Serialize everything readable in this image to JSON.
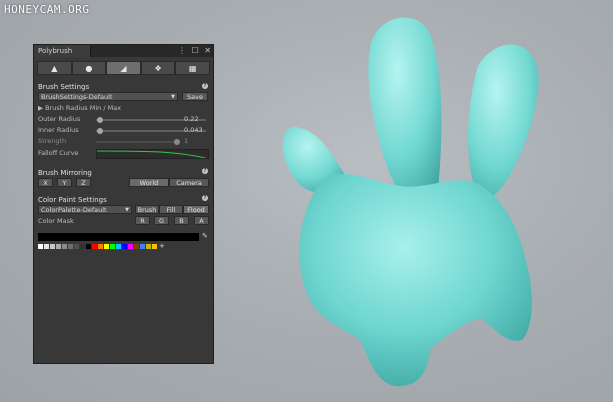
{
  "watermark": "HONEYCAM.ORG",
  "window": {
    "title": "Polybrush",
    "controls": [
      "⋮",
      "☐",
      "✕"
    ]
  },
  "toolbar": {
    "tools": [
      {
        "icon": "raise-lower-icon",
        "glyph": "▲"
      },
      {
        "icon": "smooth-icon",
        "glyph": "●"
      },
      {
        "icon": "paint-vertex-icon",
        "glyph": "◢"
      },
      {
        "icon": "scatter-prefab-icon",
        "glyph": "❖"
      },
      {
        "icon": "texture-paint-icon",
        "glyph": "▦"
      }
    ],
    "active_index": 2
  },
  "brush_settings": {
    "header": "Brush Settings",
    "preset": "BrushSettings-Default",
    "save_label": "Save",
    "radius_toggle": "Brush Radius Min / Max",
    "outer_radius_label": "Outer Radius",
    "outer_radius_value": "0.22",
    "inner_radius_label": "Inner Radius",
    "inner_radius_value": "0.043",
    "strength_label": "Strength",
    "strength_value": "1",
    "falloff_label": "Falloff Curve"
  },
  "brush_mirroring": {
    "header": "Brush Mirroring",
    "axes": [
      "X",
      "Y",
      "Z"
    ],
    "spaces": [
      "World",
      "Camera"
    ],
    "selected_space": "World"
  },
  "color_paint": {
    "header": "Color Paint Settings",
    "palette": "ColorPalette-Default",
    "modes": [
      "Brush",
      "Fill",
      "Flood"
    ],
    "selected_mode": "Flood",
    "mask_label": "Color Mask",
    "mask_channels": [
      "R",
      "G",
      "B",
      "A"
    ],
    "swatch_colors": [
      "#ffffff",
      "#e6e6e6",
      "#c8c8c8",
      "#aaaaaa",
      "#8c8c8c",
      "#6e6e6e",
      "#505050",
      "#323232",
      "#000000",
      "#ff0000",
      "#ff7f00",
      "#ffff00",
      "#00ff00",
      "#00c8ff",
      "#0000ff",
      "#ff00ff",
      "#7f3f00",
      "#3f7fff",
      "#bfbf00",
      "#ffbf00"
    ],
    "add_swatch": "+"
  },
  "colors": {
    "panel_bg": "#383838",
    "model_color": "#6fd6d0",
    "falloff_curve": "#39c24a"
  }
}
